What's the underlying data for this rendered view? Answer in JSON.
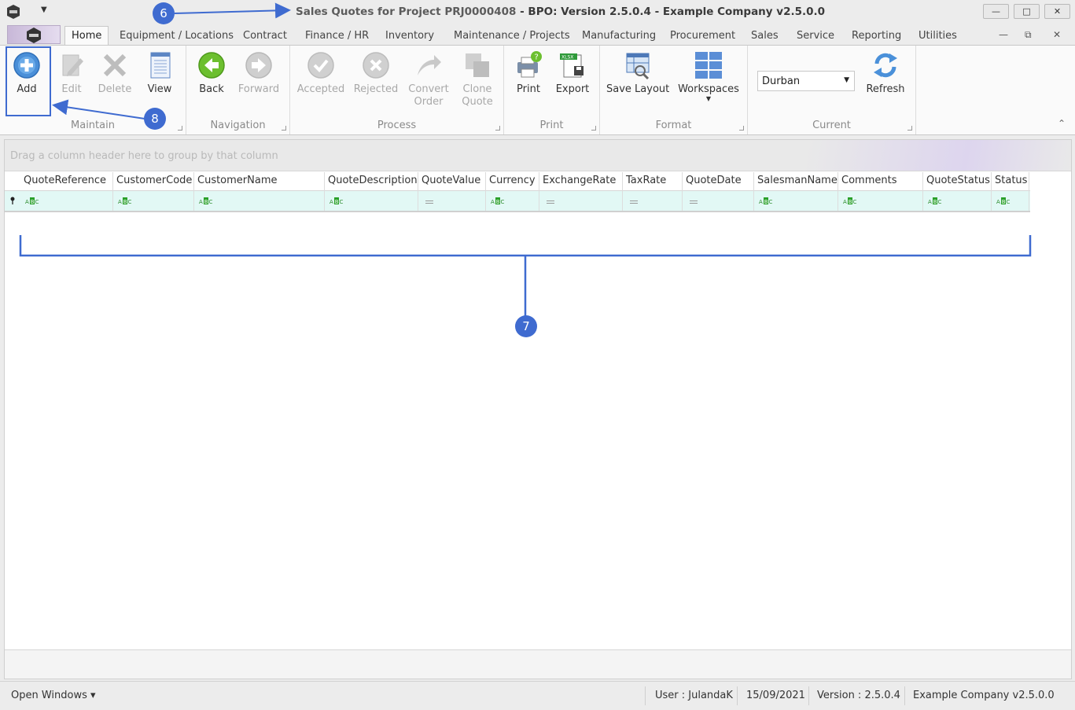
{
  "window": {
    "title_part1": "Sales Quotes for Project PRJ0000408",
    "title_part2": " - BPO: Version 2.5.0.4 - Example Company v2.5.0.0",
    "minimize": "—",
    "maximize": "□",
    "close": "✕"
  },
  "tabs": [
    "Home",
    "Equipment / Locations",
    "Contract",
    "Finance / HR",
    "Inventory",
    "Maintenance / Projects",
    "Manufacturing",
    "Procurement",
    "Sales",
    "Service",
    "Reporting",
    "Utilities"
  ],
  "ribbon": {
    "maintain": {
      "label": "Maintain",
      "add": "Add",
      "edit": "Edit",
      "delete": "Delete",
      "view": "View"
    },
    "navigation": {
      "label": "Navigation",
      "back": "Back",
      "forward": "Forward"
    },
    "process": {
      "label": "Process",
      "accepted": "Accepted",
      "rejected": "Rejected",
      "convert1": "Convert",
      "convert2": "Order",
      "clone1": "Clone",
      "clone2": "Quote"
    },
    "print": {
      "label": "Print",
      "print": "Print",
      "export": "Export"
    },
    "format": {
      "label": "Format",
      "save_layout": "Save Layout",
      "workspaces": "Workspaces"
    },
    "current": {
      "label": "Current",
      "site": "Durban",
      "refresh": "Refresh"
    }
  },
  "grid": {
    "group_hint": "Drag a column header here to group by that column",
    "columns": [
      "QuoteReference",
      "CustomerCode",
      "CustomerName",
      "QuoteDescription",
      "QuoteValue",
      "Currency",
      "ExchangeRate",
      "TaxRate",
      "QuoteDate",
      "SalesmanName",
      "Comments",
      "QuoteStatus",
      "Status"
    ],
    "filter_types": [
      "text",
      "text",
      "text",
      "text",
      "number",
      "text",
      "number",
      "number",
      "number",
      "text",
      "text",
      "text",
      "text"
    ]
  },
  "statusbar": {
    "open_windows": "Open Windows ▾",
    "user": "User : JulandaK",
    "date": "15/09/2021",
    "version": "Version : 2.5.0.4",
    "company": "Example Company v2.5.0.0"
  },
  "annotations": {
    "c6": "6",
    "c7": "7",
    "c8": "8"
  },
  "colors": {
    "accent": "#3f6bd0",
    "filter_row": "#e2f8f5"
  }
}
